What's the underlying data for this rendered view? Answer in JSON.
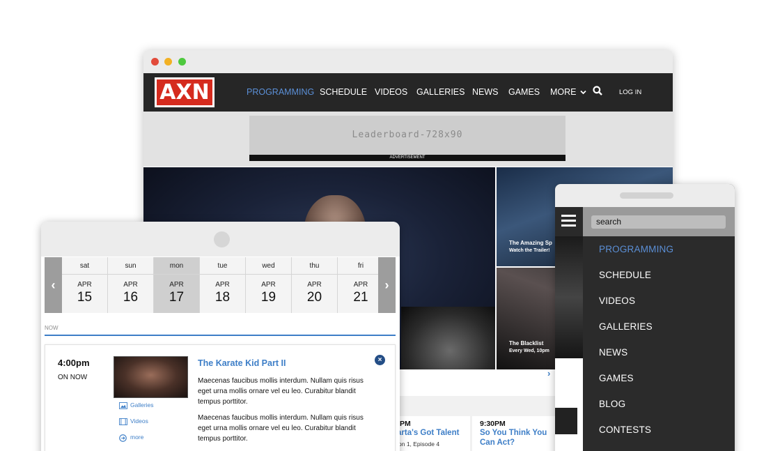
{
  "desktop": {
    "logo_text": "AXN",
    "nav": {
      "programming": "PROGRAMMING",
      "schedule": "SCHEDULE",
      "videos": "VIDEOS",
      "galleries": "GALLERIES",
      "news": "NEWS",
      "games": "GAMES",
      "more": "MORE",
      "login": "LOG IN"
    },
    "ad": {
      "box_text": "Leaderboard-728x90",
      "label": "ADVERTISEMENT"
    },
    "tiles": [
      {
        "title": "The Amazing Sp",
        "subtitle": "Watch the Trailer!"
      },
      {
        "title": "The Blacklist",
        "subtitle": "Every Wed, 10pm"
      }
    ],
    "schedule": [
      {
        "time": "PM",
        "title": "arta's Got Talent",
        "subtitle": "on 1, Episode 4"
      },
      {
        "time": "9:30PM",
        "title": "So You Think You",
        "title2": "Can Act?"
      }
    ]
  },
  "mobile": {
    "search_value": "search",
    "menu": [
      {
        "label": "PROGRAMMING",
        "active": true
      },
      {
        "label": "SCHEDULE",
        "active": false
      },
      {
        "label": "VIDEOS",
        "active": false
      },
      {
        "label": "GALLERIES",
        "active": false
      },
      {
        "label": "NEWS",
        "active": false
      },
      {
        "label": "GAMES",
        "active": false
      },
      {
        "label": "BLOG",
        "active": false
      },
      {
        "label": "CONTESTS",
        "active": false
      }
    ]
  },
  "tablet": {
    "days": [
      {
        "name": "sat",
        "month": "APR",
        "num": "15",
        "selected": false
      },
      {
        "name": "sun",
        "month": "APR",
        "num": "16",
        "selected": false
      },
      {
        "name": "mon",
        "month": "APR",
        "num": "17",
        "selected": true
      },
      {
        "name": "tue",
        "month": "APR",
        "num": "18",
        "selected": false
      },
      {
        "name": "wed",
        "month": "APR",
        "num": "19",
        "selected": false
      },
      {
        "name": "thu",
        "month": "APR",
        "num": "20",
        "selected": false
      },
      {
        "name": "fri",
        "month": "APR",
        "num": "21",
        "selected": false
      }
    ],
    "now_label": "NOW",
    "program": {
      "time": "4:00pm",
      "status": "ON NOW",
      "title": "The Karate Kid Part II",
      "desc1": "Maecenas faucibus mollis interdum. Nullam quis risus eget urna mollis ornare vel eu leo. Curabitur blandit tempus porttitor.",
      "desc2": "Maecenas faucibus mollis interdum. Nullam quis risus eget urna mollis ornare vel eu leo. Curabitur blandit tempus porttitor.",
      "links": {
        "galleries": "Galleries",
        "videos": "Videos",
        "more": "more"
      }
    }
  },
  "colors": {
    "accent": "#3d7ec7",
    "nav_bg": "#262626",
    "logo_red": "#d52b1e"
  }
}
